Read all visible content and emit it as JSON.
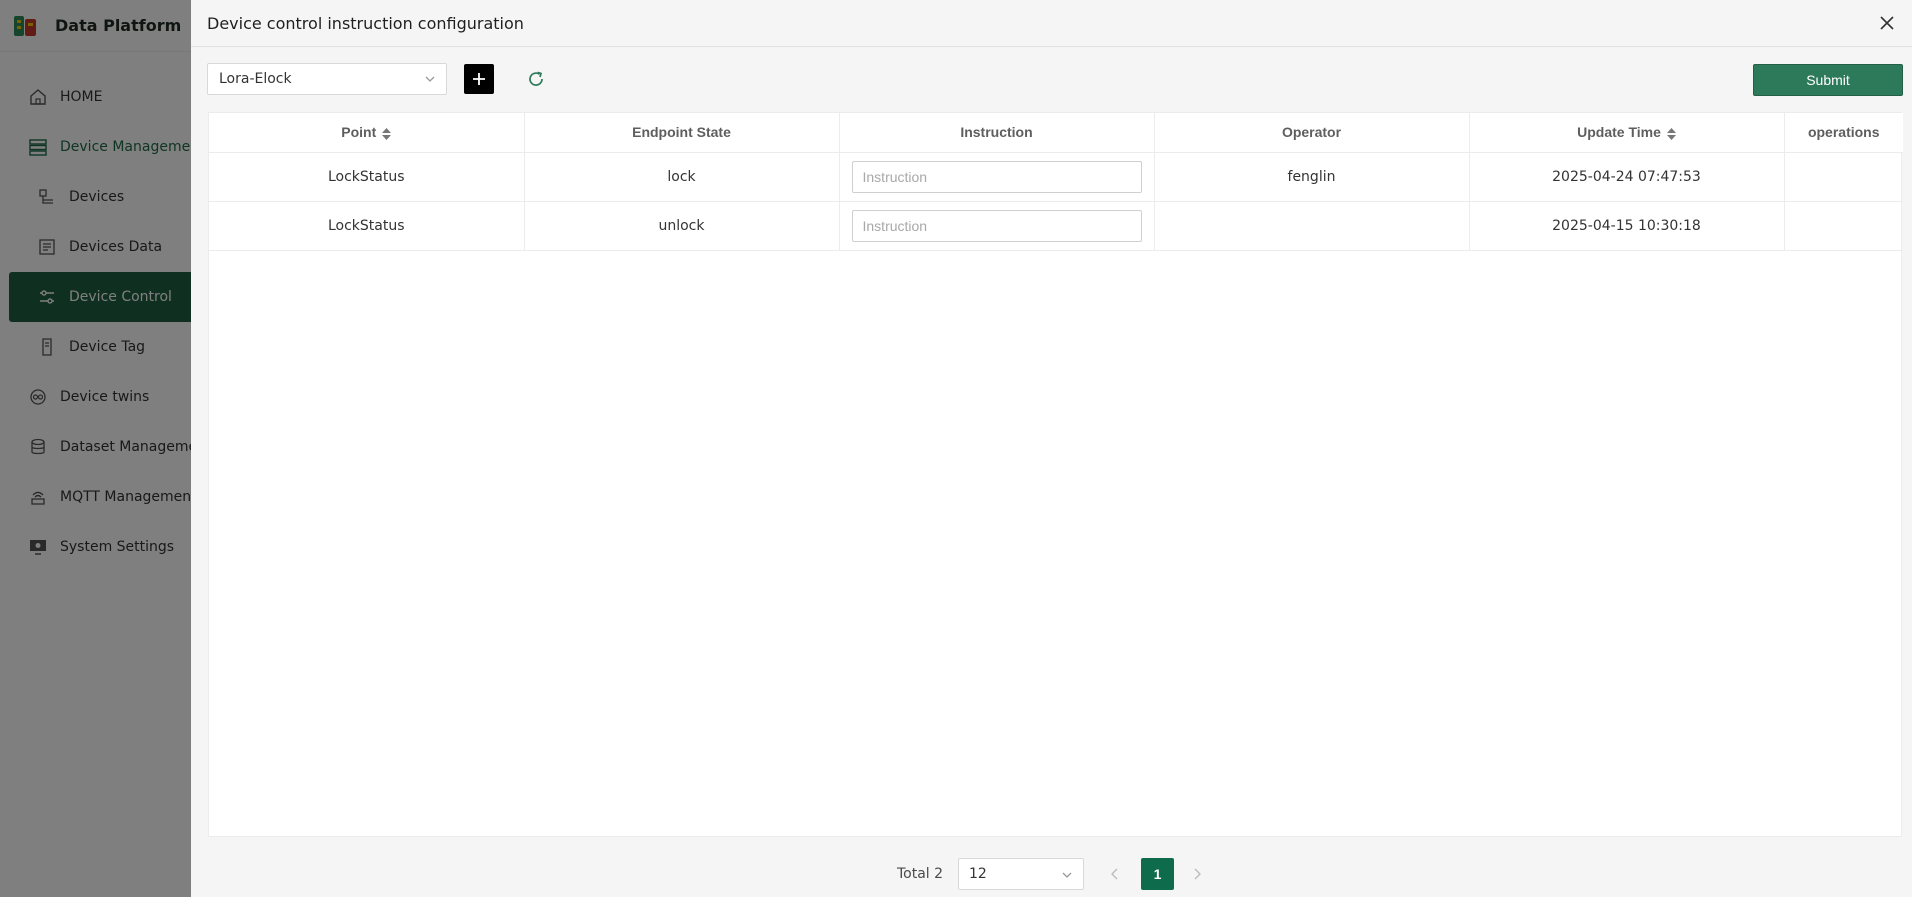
{
  "app": {
    "title": "Data Platform"
  },
  "sidebar": {
    "items": [
      {
        "label": "HOME",
        "icon": "home-icon"
      },
      {
        "label": "Device Management",
        "icon": "device-management-icon"
      },
      {
        "label": "Devices",
        "icon": "devices-icon"
      },
      {
        "label": "Devices Data",
        "icon": "devices-data-icon"
      },
      {
        "label": "Device Control",
        "icon": "device-control-icon"
      },
      {
        "label": "Device Tag",
        "icon": "device-tag-icon"
      },
      {
        "label": "Device twins",
        "icon": "device-twins-icon"
      },
      {
        "label": "Dataset Management",
        "icon": "dataset-icon"
      },
      {
        "label": "MQTT Management",
        "icon": "mqtt-icon"
      },
      {
        "label": "System Settings",
        "icon": "system-settings-icon"
      }
    ],
    "active_item": "Device Control"
  },
  "drawer": {
    "title": "Device control instruction configuration",
    "device_select": {
      "value": "Lora-Elock"
    },
    "submit_label": "Submit"
  },
  "table": {
    "columns": [
      "Point",
      "Endpoint State",
      "Instruction",
      "Operator",
      "Update Time",
      "operations"
    ],
    "rows": [
      {
        "point": "LockStatus",
        "endpoint_state": "lock",
        "instruction_placeholder": "Instruction",
        "operator": "fenglin",
        "update_time": "2025-04-24 07:47:53",
        "operations": ""
      },
      {
        "point": "LockStatus",
        "endpoint_state": "unlock",
        "instruction_placeholder": "Instruction",
        "operator": "",
        "update_time": "2025-04-15 10:30:18",
        "operations": ""
      }
    ]
  },
  "pagination": {
    "total_label": "Total 2",
    "page_size": "12",
    "current_page": "1"
  },
  "colors": {
    "accent": "#0e6b4c",
    "submit": "#2d7a5b",
    "active_menu": "#1e5f42"
  }
}
